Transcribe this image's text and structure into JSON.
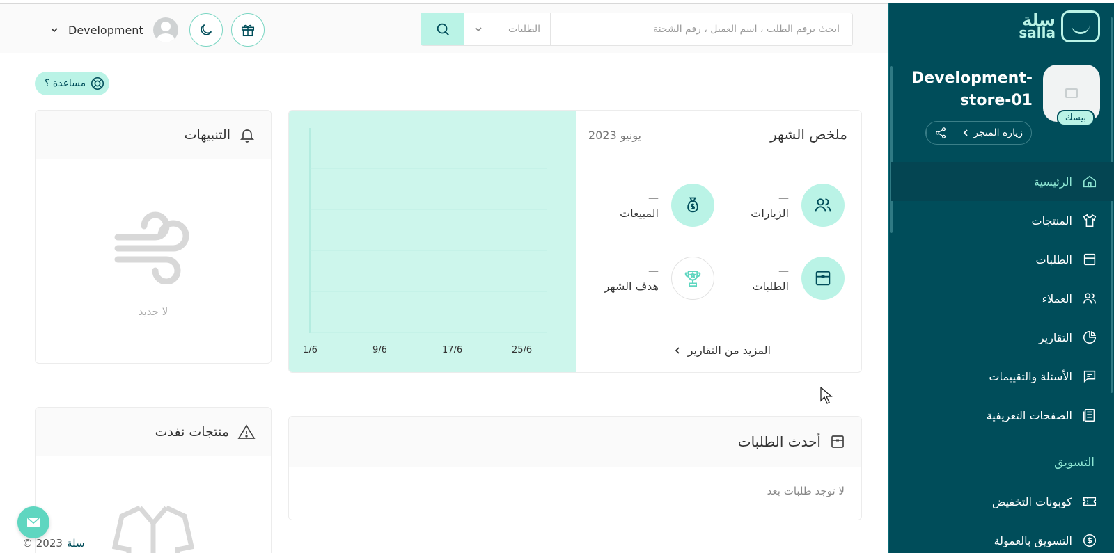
{
  "sidebar": {
    "logo_ar": "سلة",
    "logo_en": "salla",
    "store_name": "Development-store-01",
    "plan_badge": "بيسك",
    "visit_store": "زيارة المتجر",
    "nav": [
      {
        "label": "الرئيسية",
        "icon": "home-icon",
        "active": true
      },
      {
        "label": "المنتجات",
        "icon": "shirt-icon"
      },
      {
        "label": "الطلبات",
        "icon": "box-icon"
      },
      {
        "label": "العملاء",
        "icon": "users-icon"
      },
      {
        "label": "التقارير",
        "icon": "pie-chart-icon"
      },
      {
        "label": "الأسئلة والتقييمات",
        "icon": "message-icon"
      },
      {
        "label": "الصفحات التعريفية",
        "icon": "document-icon"
      }
    ],
    "section_marketing": "التسويق",
    "marketing": [
      {
        "label": "كوبونات التخفيض",
        "icon": "ticket-icon"
      },
      {
        "label": "التسويق بالعمولة",
        "icon": "dollar-icon"
      }
    ]
  },
  "header": {
    "search_placeholder": "ابحث برقم الطلب ، اسم العميل ، رقم الشحنة",
    "search_scope": "الطلبات",
    "user_name": "Development"
  },
  "help": {
    "label": "مساعدة ؟"
  },
  "alerts": {
    "title": "التنبيهات",
    "empty": "لا جديد"
  },
  "summary": {
    "title": "ملخص الشهر",
    "date": "يونيو 2023",
    "stats": {
      "visits": {
        "label": "الزيارات",
        "value": "—"
      },
      "sales": {
        "label": "المبيعات",
        "value": "—"
      },
      "orders": {
        "label": "الطلبات",
        "value": "—"
      },
      "goal": {
        "label": "هدف الشهر",
        "value": "—"
      }
    },
    "more_reports": "المزيد من التقارير"
  },
  "chart_data": {
    "type": "line",
    "x": [
      "1/6",
      "9/6",
      "17/6",
      "25/6"
    ],
    "series": [],
    "grid": true,
    "colors": {
      "background": "#cdf6ec"
    }
  },
  "latest_orders": {
    "title": "أحدث الطلبات",
    "empty": "لا توجد طلبات بعد"
  },
  "out_of_stock": {
    "title": "منتجات نفدت"
  },
  "footer": {
    "brand": "سلة",
    "copyright": "© 2023"
  },
  "colors": {
    "sidebar": "#004d5a",
    "accent": "#baf3e6",
    "accent_text": "#8ee6d3"
  }
}
